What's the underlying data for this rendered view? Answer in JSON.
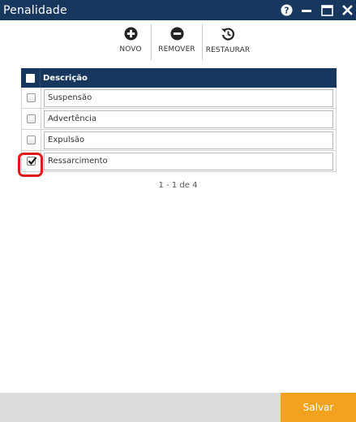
{
  "window": {
    "title": "Penalidade"
  },
  "controls": {
    "help": "help-icon",
    "minimize": "minimize-icon",
    "maximize": "maximize-icon",
    "close": "close-icon"
  },
  "toolbar": {
    "new_label": "NOVO",
    "remove_label": "REMOVER",
    "restore_label": "RESTAURAR"
  },
  "grid": {
    "header": "Descrição",
    "rows": [
      {
        "label": "Suspensão",
        "checked": false
      },
      {
        "label": "Advertência",
        "checked": false
      },
      {
        "label": "Expulsão",
        "checked": false
      },
      {
        "label": "Ressarcimento",
        "checked": true
      }
    ]
  },
  "pager": {
    "text": "1 - 1 de 4"
  },
  "footer": {
    "save_label": "Salvar"
  },
  "colors": {
    "titlebar": "#17375e",
    "save": "#f2a21f",
    "highlight": "#e01a1a",
    "footer": "#dcdcdc"
  }
}
